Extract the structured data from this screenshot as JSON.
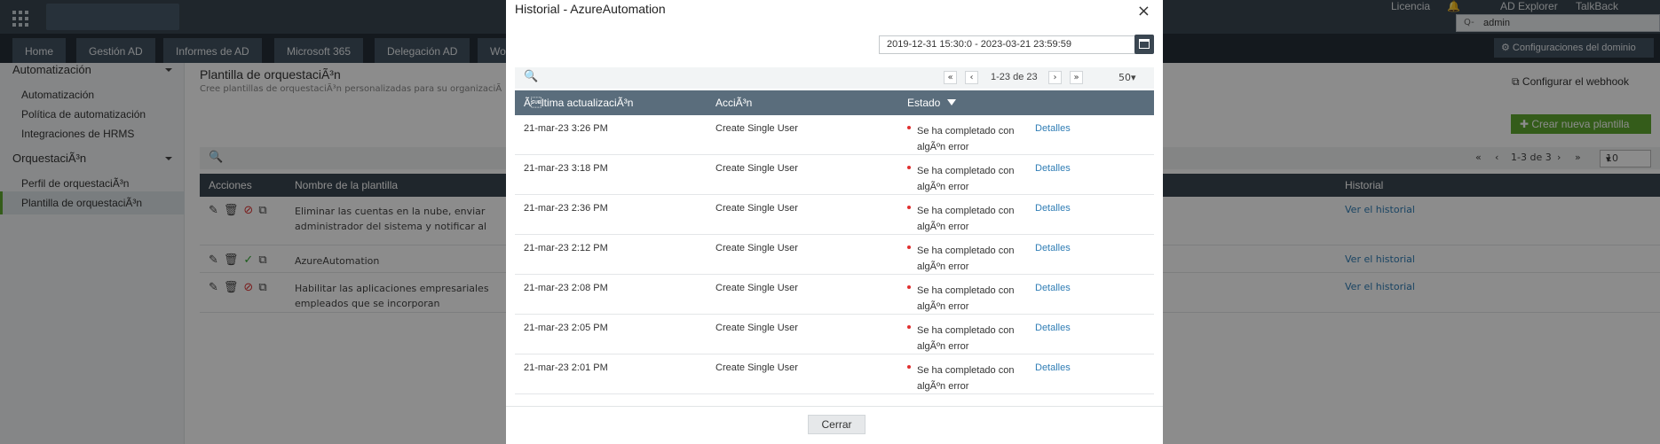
{
  "topbar": {
    "links": [
      "Licencia",
      "AD Explorer",
      "TalkBack"
    ],
    "search_value": "admin"
  },
  "nav": {
    "tabs": [
      "Home",
      "Gestión AD",
      "Informes de AD",
      "Microsoft 365",
      "Delegación AD",
      "Wo"
    ],
    "domain_settings": "Configuraciones del dominio"
  },
  "sidebar": {
    "section1": "Automatización",
    "items1": [
      "Automatización",
      "Política de automatización",
      "Integraciones de HRMS"
    ],
    "section2": "OrquestaciÃ³n",
    "items2": [
      "Perfil de orquestaciÃ³n",
      "Plantilla de orquestaciÃ³n"
    ]
  },
  "main": {
    "title": "Plantilla de orquestaciÃ³n",
    "subtitle": "Cree plantillas de orquestaciÃ³n personalizadas para su organizaciÃ",
    "webhook": "Configurar el webhook",
    "create_button": "Crear nueva plantilla",
    "pager_text": "1-3 de 3",
    "page_size": "10",
    "columns": [
      "Acciones",
      "Nombre de la plantilla",
      "Historial"
    ],
    "rows": [
      {
        "name_line1": "Eliminar las cuentas en la nube, enviar",
        "name_line2": "administrador del sistema y notificar al",
        "history": "Ver el historial"
      },
      {
        "name_line1": "AzureAutomation",
        "name_line2": "",
        "history": "Ver el historial"
      },
      {
        "name_line1": "Habilitar las aplicaciones empresariales",
        "name_line2": "empleados que se incorporan",
        "history": "Ver el historial"
      }
    ]
  },
  "modal": {
    "title": "Historial - AzureAutomation",
    "date_range": "2019-12-31 15:30:0 - 2023-03-21 23:59:59",
    "pager_text": "1-23 de 23",
    "page_size": "50",
    "columns": {
      "date": "Ã\u001altima actualizaciÃ³n",
      "action": "AcciÃ³n",
      "status": "Estado"
    },
    "rows": [
      {
        "date": "21-mar-23 3:26 PM",
        "action": "Create Single User",
        "status": "Se ha completado con algÃºn error",
        "link": "Detalles"
      },
      {
        "date": "21-mar-23 3:18 PM",
        "action": "Create Single User",
        "status": "Se ha completado con algÃºn error",
        "link": "Detalles"
      },
      {
        "date": "21-mar-23 2:36 PM",
        "action": "Create Single User",
        "status": "Se ha completado con algÃºn error",
        "link": "Detalles"
      },
      {
        "date": "21-mar-23 2:12 PM",
        "action": "Create Single User",
        "status": "Se ha completado con algÃºn error",
        "link": "Detalles"
      },
      {
        "date": "21-mar-23 2:08 PM",
        "action": "Create Single User",
        "status": "Se ha completado con algÃºn error",
        "link": "Detalles"
      },
      {
        "date": "21-mar-23 2:05 PM",
        "action": "Create Single User",
        "status": "Se ha completado con algÃºn error",
        "link": "Detalles"
      },
      {
        "date": "21-mar-23 2:01 PM",
        "action": "Create Single User",
        "status": "Se ha completado con algÃºn error",
        "link": "Detalles"
      }
    ],
    "close_button": "Cerrar"
  }
}
